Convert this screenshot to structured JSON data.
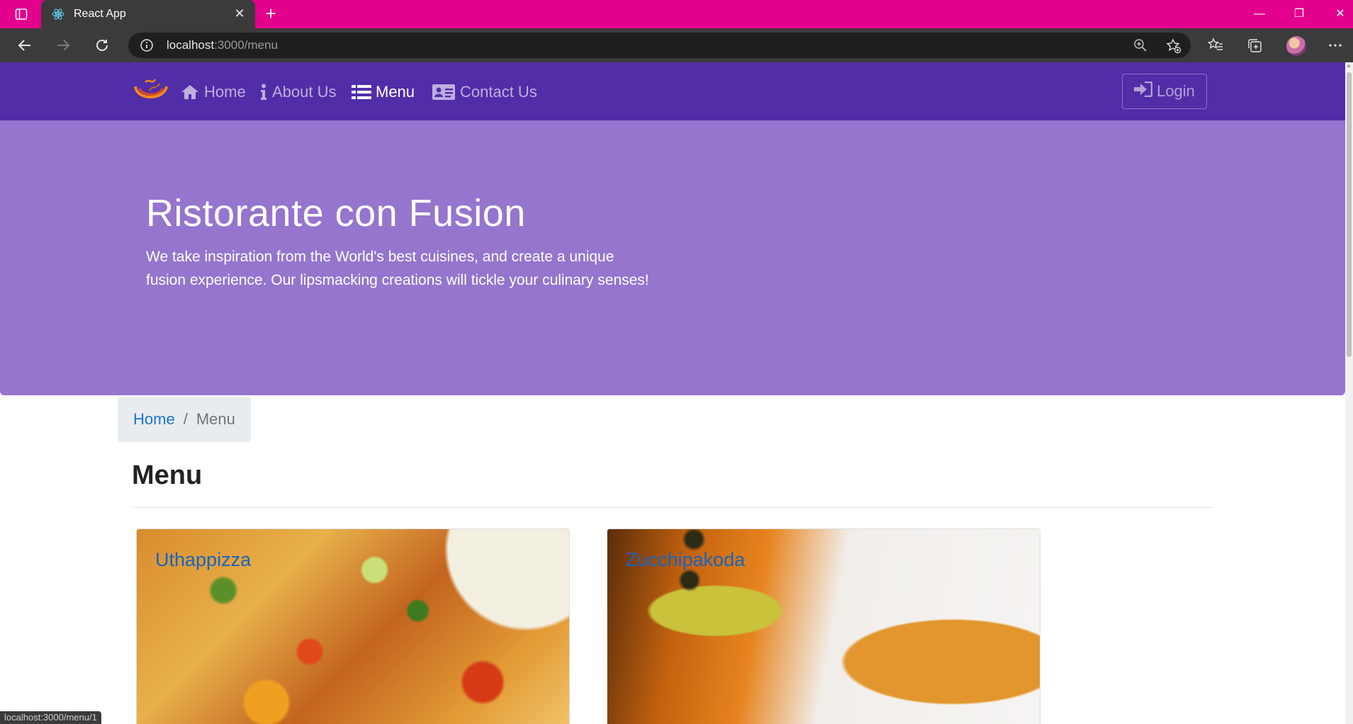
{
  "browser": {
    "tab_title": "React App",
    "url_host": "localhost",
    "url_path": ":3000/menu",
    "status_url": "localhost:3000/menu/1"
  },
  "navbar": {
    "links": [
      {
        "label": "Home",
        "icon": "home-icon",
        "active": false
      },
      {
        "label": "About Us",
        "icon": "info-icon",
        "active": false
      },
      {
        "label": "Menu",
        "icon": "list-icon",
        "active": true
      },
      {
        "label": "Contact Us",
        "icon": "address-card-icon",
        "active": false
      }
    ],
    "login_label": "Login"
  },
  "jumbotron": {
    "title": "Ristorante con Fusion",
    "text": "We take inspiration from the World's best cuisines, and create a unique fusion experience. Our lipsmacking creations will tickle your culinary senses!"
  },
  "breadcrumb": {
    "home": "Home",
    "separator": "/",
    "current": "Menu"
  },
  "menu": {
    "heading": "Menu",
    "dishes": [
      {
        "name": "Uthappizza"
      },
      {
        "name": "Zucchipakoda"
      }
    ]
  },
  "colors": {
    "tabbar": "#e3008c",
    "navbar": "#512da8",
    "jumbotron": "#9575cd",
    "link": "#1976d2"
  }
}
